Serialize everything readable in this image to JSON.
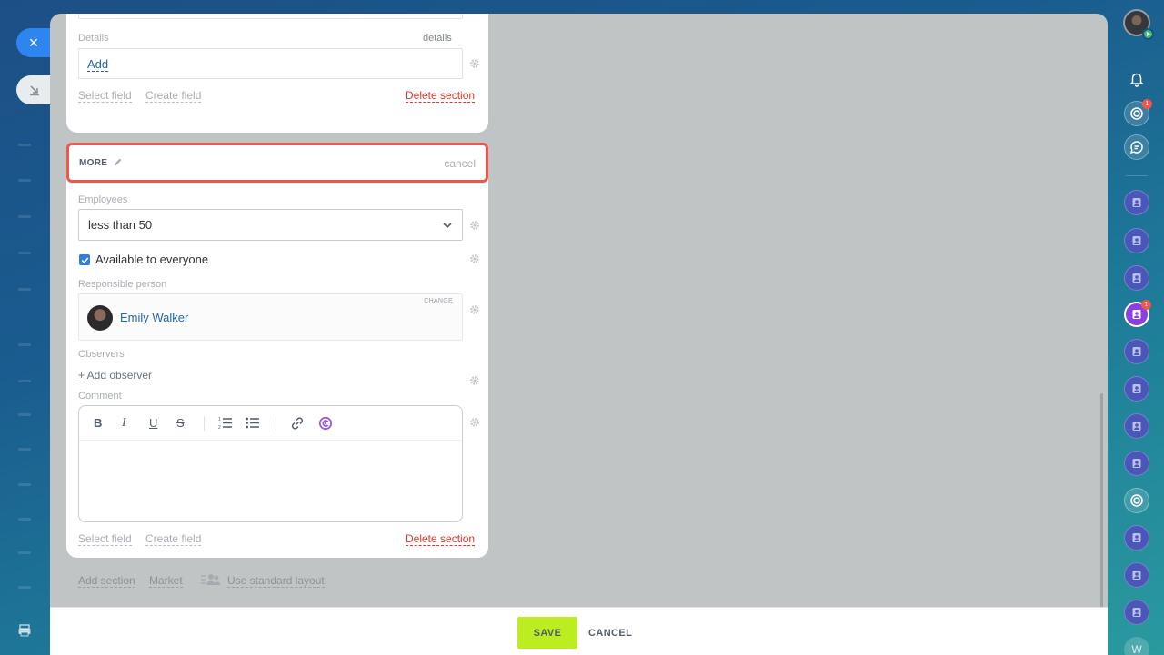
{
  "left": {
    "close_symbol": "×",
    "collapse_symbol": "⇲"
  },
  "card_top": {
    "details_label": "Details",
    "details_hint": "details",
    "add_link": "Add",
    "select_field": "Select field",
    "create_field": "Create field",
    "delete_section": "Delete section"
  },
  "section": {
    "title": "MORE",
    "cancel": "cancel",
    "employees_label": "Employees",
    "employees_value": "less than 50",
    "available_label": "Available to everyone",
    "available_checked": true,
    "responsible_label": "Responsible person",
    "change_label": "CHANGE",
    "responsible_name": "Emily Walker",
    "observers_label": "Observers",
    "add_observer": "+ Add observer",
    "comment_label": "Comment",
    "toolbar": {
      "bold": "B",
      "italic": "I",
      "underline": "U",
      "strike": "S"
    },
    "select_field": "Select field",
    "create_field": "Create field",
    "delete_section": "Delete section"
  },
  "bottom_links": {
    "add_section": "Add section",
    "market": "Market",
    "use_standard_layout": "Use standard layout"
  },
  "footer": {
    "save": "SAVE",
    "cancel": "CANCEL"
  },
  "rightbar": {
    "counter_badge": "1",
    "contact_badge": "1",
    "last_letter": "W"
  },
  "colors": {
    "accent": "#2d86ef",
    "save_green": "#bbed21",
    "danger": "#e4352a",
    "highlight_border": "#f2554a"
  }
}
